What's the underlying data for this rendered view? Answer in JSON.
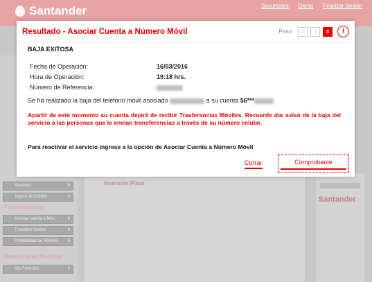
{
  "background": {
    "brand": "Santander",
    "top_links": [
      "Sucursales",
      "Demo",
      "Finalizar Sesión"
    ],
    "left_sections": [
      {
        "label": "Transferencias"
      },
      {
        "label": "Operaciones favoritas"
      }
    ],
    "left_items": [
      "Servicios",
      "Tarjeta de Crédito",
      "Asociar cuenta a Móv...",
      "Transferir fondos",
      "Portabilidad de Nómina",
      "Mis Favoritos"
    ],
    "center_row": "Inversión Plazo",
    "right_logo": "Santander"
  },
  "modal": {
    "title": "Resultado - Asociar Cuenta a Número Móvil",
    "step_label": "Paso:",
    "steps": [
      "1",
      "2",
      "3"
    ],
    "active_step": "3",
    "info_icon": "i",
    "status": "BAJA EXITOSA",
    "fields": [
      {
        "label": "Fecha de Operación:",
        "value": "16/03/2016"
      },
      {
        "label": "Hora de Operación:",
        "value": "19:18 hrs."
      },
      {
        "label": "Número de Referencia:",
        "value": ""
      }
    ],
    "message_part1": "Se ha realizado la baja del teléfono móvil asociado",
    "message_part2": "a su cuenta",
    "account_masked": "56***",
    "warning": "Apartir de este momento su cuenta dejará de recibir Trasferencias Móviles. Recuerde dar aviso de la baja del servicio a las personas que le envían transferencias a través de su número celular.",
    "reactivate": "Para reactivar el servicio ingrese a la opción de Asociar Cuenta a Número Móvil",
    "close_label": "Cerrar",
    "receipt_label": "Comprobante"
  },
  "colors": {
    "accent": "#e60000",
    "overlay": "#c8c8c8"
  }
}
